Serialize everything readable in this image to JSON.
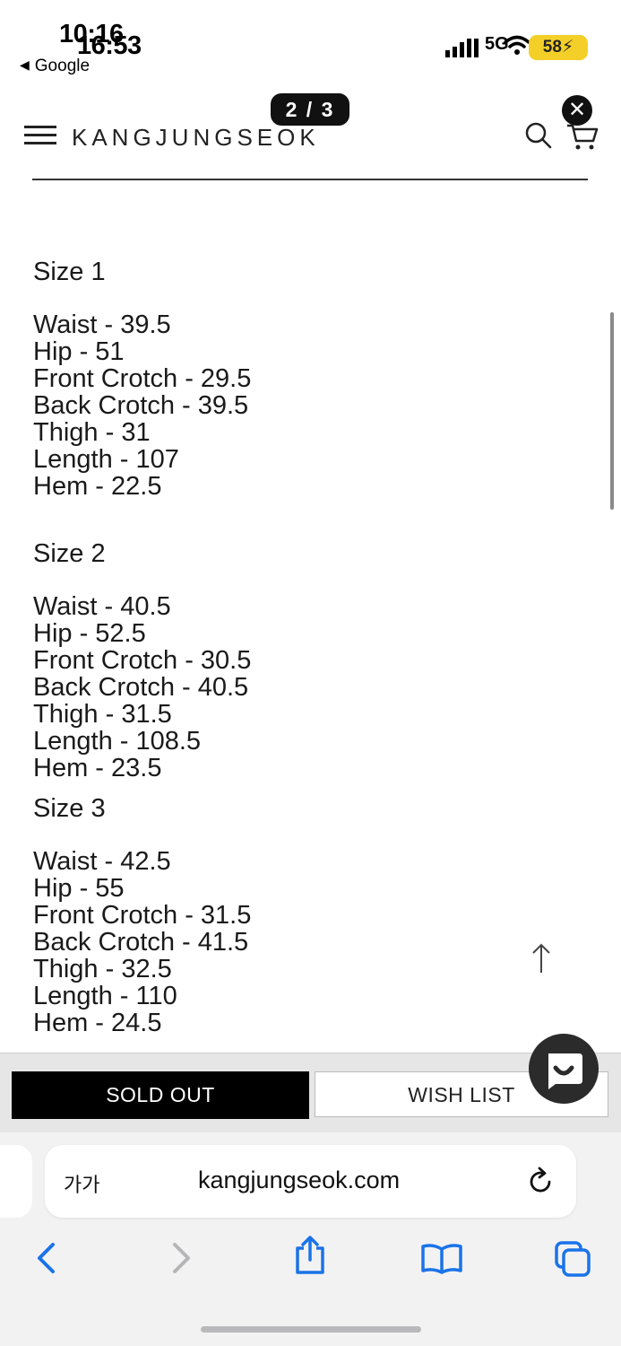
{
  "status_bar": {
    "time_back": "10:16",
    "time_front": "16:53",
    "back_app": "Google",
    "network": "5G",
    "battery": "58"
  },
  "header": {
    "page_indicator": "2 / 3",
    "brand": "KANGJUNGSEOK"
  },
  "sizes": [
    {
      "title": "Size 1",
      "rows": [
        "Waist - 39.5",
        "Hip - 51",
        "Front Crotch - 29.5",
        "Back Crotch - 39.5",
        "Thigh - 31",
        "Length - 107",
        "Hem - 22.5"
      ]
    },
    {
      "title": "Size 2",
      "rows": [
        "Waist - 40.5",
        "Hip - 52.5",
        "Front Crotch - 30.5",
        "Back Crotch - 40.5",
        "Thigh - 31.5",
        "Length - 108.5",
        "Hem - 23.5"
      ]
    },
    {
      "title": "Size 3",
      "rows": [
        "Waist - 42.5",
        "Hip - 55",
        "Front Crotch - 31.5",
        "Back Crotch - 41.5",
        "Thigh - 32.5",
        "Length - 110",
        "Hem - 24.5"
      ]
    }
  ],
  "actions": {
    "sold_out": "SOLD OUT",
    "wish_list": "WISH LIST"
  },
  "browser": {
    "text_size_label": "가가",
    "url": "kangjungseok.com"
  }
}
